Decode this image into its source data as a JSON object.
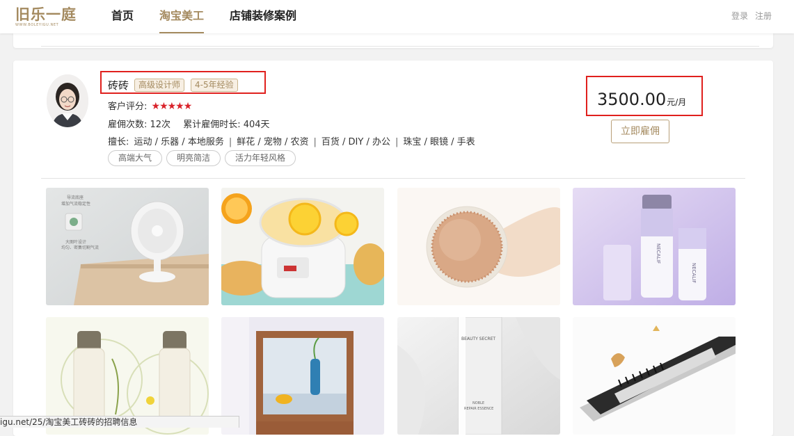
{
  "header": {
    "logo_text": "旧乐一庭",
    "logo_sub": "WWW.BOLEYIGU.NET",
    "nav": [
      {
        "label": "首页",
        "active": false
      },
      {
        "label": "淘宝美工",
        "active": true
      },
      {
        "label": "店铺装修案例",
        "active": false
      }
    ],
    "login_label": "登录",
    "register_label": "注册"
  },
  "designer": {
    "name": "砖砖",
    "level_tag": "高级设计师",
    "experience_tag": "4-5年经验",
    "rating_label": "客户评分:",
    "rating_stars": 5,
    "stars_text": "★★★★★",
    "hire_count_text": "雇佣次数: 12次",
    "hire_duration_text": "累计雇佣时长: 404天",
    "specialty_label": "擅长:",
    "specialties": [
      "运动 / 乐器 / 本地服务",
      "鲜花 / 宠物 / 农资",
      "百货 / DIY / 办公",
      "珠宝 / 眼镜 / 手表"
    ],
    "styles": [
      "高端大气",
      "明亮简洁",
      "活力年轻风格"
    ],
    "price": "3500.00",
    "price_unit": "元/月",
    "hire_button": "立即雇佣"
  },
  "portfolio": [
    {
      "name": "fan-product",
      "texts": [
        "导流底座",
        "增加气流稳定性",
        "大图叶设计",
        "均匀、密集切割气流"
      ]
    },
    {
      "name": "lemon-pot",
      "texts": []
    },
    {
      "name": "sponge-cushion",
      "texts": []
    },
    {
      "name": "skincare-bottles",
      "texts": [
        "NECALIF",
        "NECALIF"
      ]
    },
    {
      "name": "cream-bottles",
      "texts": []
    },
    {
      "name": "mirror-stand",
      "texts": []
    },
    {
      "name": "beauty-secret",
      "texts": [
        "BEAUTY SECRET",
        "NOBLE",
        "REPAIR ESSENCE"
      ]
    },
    {
      "name": "curling-brush",
      "texts": []
    }
  ],
  "status_bar": {
    "url": "igu.net/25/淘宝美工砖砖的招聘信息"
  },
  "colors": {
    "accent": "#a48a5f",
    "star": "#d9222a",
    "highlight": "#e0201d"
  }
}
